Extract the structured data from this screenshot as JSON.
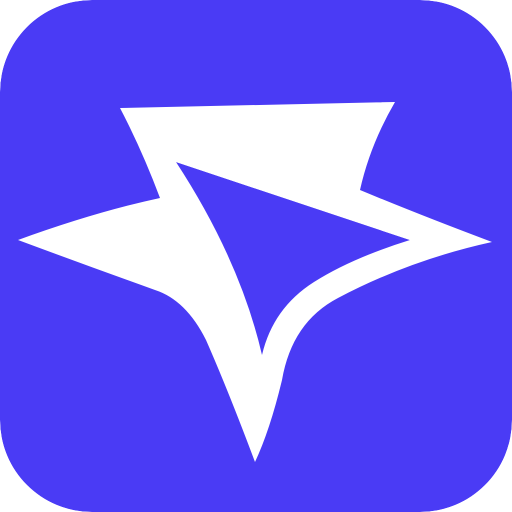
{
  "icon": {
    "name": "star-logo-icon",
    "colors": {
      "background": "#4A3BF5",
      "star": "#FFFFFF",
      "inner": "#4A3BF5"
    }
  }
}
